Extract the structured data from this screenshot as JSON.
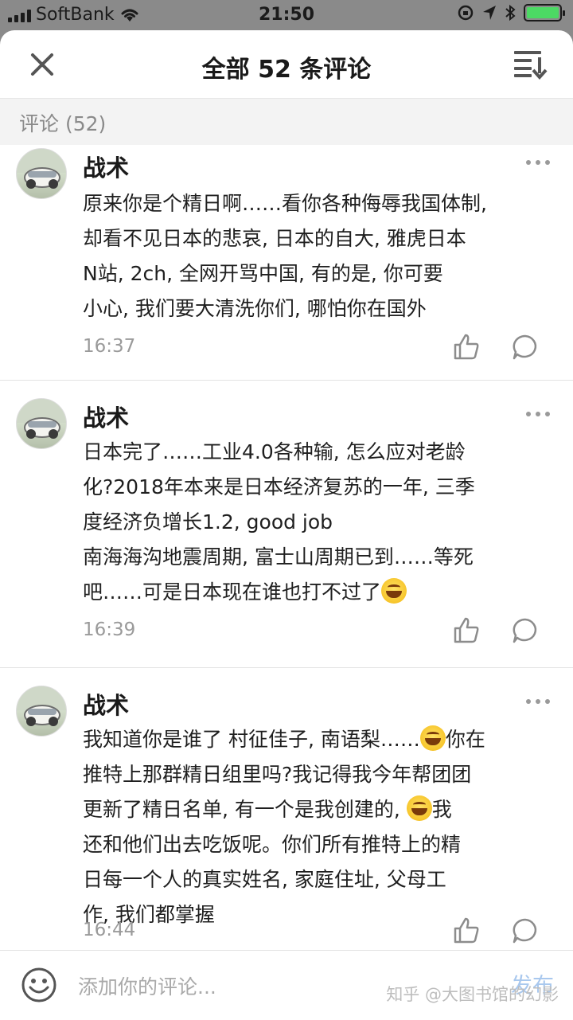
{
  "status_bar": {
    "carrier": "SoftBank",
    "time": "21:50",
    "battery_level": 1.0,
    "battery_color": "#4cd964"
  },
  "header": {
    "title": "全部 52 条评论",
    "close_icon": "close-icon",
    "sort_icon": "sort-icon"
  },
  "section": {
    "label": "评论 (52)"
  },
  "comments": [
    {
      "name": "战术",
      "lines": [
        "原来你是个精日啊……看你各种侮辱我国体制,",
        "却看不见日本的悲哀, 日本的自大, 雅虎日本",
        "N站, 2ch, 全网开骂中国, 有的是, 你可要",
        "小心, 我们要大清洗你们, 哪怕你在国外"
      ],
      "time": "16:37"
    },
    {
      "name": "战术",
      "lines": [
        "日本完了……工业4.0各种输, 怎么应对老龄",
        "化?2018年本来是日本经济复苏的一年, 三季",
        "度经济负增长1.2, good job",
        "南海海沟地震周期, 富士山周期已到……等死",
        "吧……可是日本现在谁也打不过了"
      ],
      "time": "16:39"
    },
    {
      "name": "战术",
      "lines": [
        "我知道你是谁了 村征佳子, 南语梨……",
        "你在",
        "推特上那群精日组里吗?我记得我今年帮团团",
        "更新了精日名单, 有一个是我创建的, ",
        "我",
        "还和他们出去吃饭呢。你们所有推特上的精",
        "日每一个人的真实姓名, 家庭住址, 父母工",
        "作, 我们都掌握"
      ],
      "time": "16:44"
    }
  ],
  "input_bar": {
    "placeholder": "添加你的评论...",
    "publish_label": "发布",
    "emoji_icon": "smiley-icon"
  },
  "watermark": "知乎 @大图书馆的幻影"
}
